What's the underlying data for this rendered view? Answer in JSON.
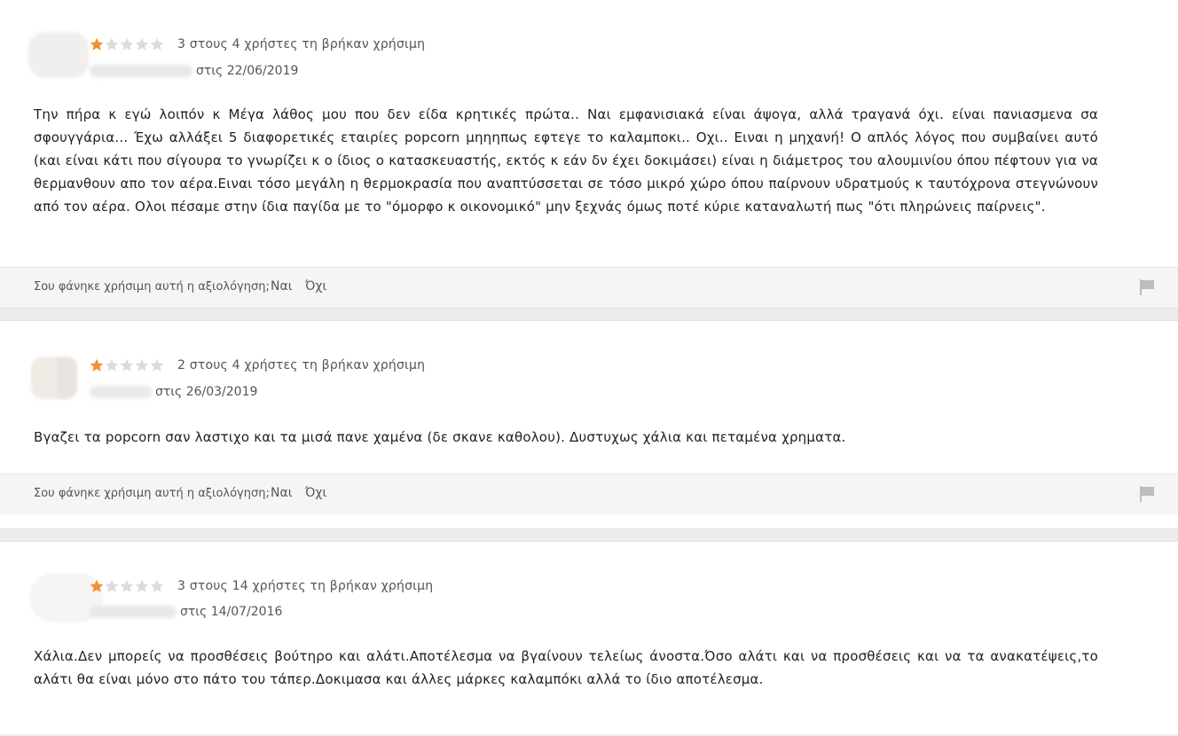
{
  "colors": {
    "star_filled": "#f0912f",
    "star_empty": "#dcdcdc",
    "flag": "#bdbdbd"
  },
  "reviews": [
    {
      "rating": 1,
      "max_rating": 5,
      "helpful_text": "3 στους 4 χρήστες τη βρήκαν χρήσιμη",
      "date_text": "στις 22/06/2019",
      "body": "Την πήρα κ εγώ λοιπόν κ Μέγα λάθος μου που δεν είδα κρητικές πρώτα.. Ναι εμφανισιακά είναι άψογα, αλλά τραγανά όχι. είναι πανιασμενα σα σφουγγάρια... Έχω αλλάξει 5 διαφορετικές εταιρίες popcorn μηηηπως εφτεγε το καλαμποκι.. Οχι.. Ειναι η μηχανή! Ο απλός λόγος που συμβαίνει αυτό (και είναι κάτι που σίγουρα το γνωρίζει κ ο ίδιος ο κατασκευαστής, εκτός κ εάν δν έχει δοκιμάσει) είναι η διάμετρος του αλουμινίου όπου πέφτουν για να θερμανθουν απο τον αέρα.Ειναι τόσο μεγάλη η θερμοκρασία που αναπτύσσεται σε τόσο μικρό χώρο όπου παίρνουν υδρατμούς κ ταυτόχρονα στεγνώνουν από τον αέρα. Ολοι πέσαμε στην ίδια παγίδα με το \"όμορφο κ οικονομικό\" μην ξεχνάς όμως ποτέ κύριε καταναλωτή πως \"ότι πληρώνεις παίρνεις\".",
      "footer_question": "Σου φάνηκε χρήσιμη αυτή η αξιολόγηση;",
      "yes_label": "Ναι",
      "no_label": "Όχι"
    },
    {
      "rating": 1,
      "max_rating": 5,
      "helpful_text": "2 στους 4 χρήστες τη βρήκαν χρήσιμη",
      "date_text": "στις 26/03/2019",
      "body": "Βγαζει τα popcorn σαν λαστιχο και τα μισά πανε χαμένα (δε σκανε καθολου). Δυστυχως χάλια και πεταμένα χρηματα.",
      "footer_question": "Σου φάνηκε χρήσιμη αυτή η αξιολόγηση;",
      "yes_label": "Ναι",
      "no_label": "Όχι"
    },
    {
      "rating": 1,
      "max_rating": 5,
      "helpful_text": "3 στους 14 χρήστες τη βρήκαν χρήσιμη",
      "date_text": "στις 14/07/2016",
      "body": "Χάλια.Δεν μπορείς να προσθέσεις βούτηρο και αλάτι.Αποτέλεσμα να βγαίνουν τελείως άνοστα.Όσο αλάτι και να προσθέσεις και να τα ανακατέψεις,το αλάτι θα είναι μόνο στο πάτο του τάπερ.Δοκιμασα και άλλες μάρκες καλαμπόκι αλλά το ίδιο αποτέλεσμα."
    }
  ]
}
